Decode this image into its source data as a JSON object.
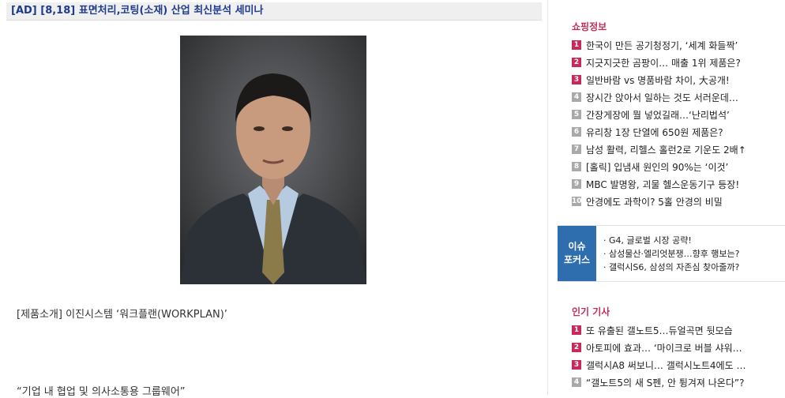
{
  "ad": {
    "title": "[AD] [8,18] 표면처리,코팅(소재) 산업 최신분석 세미나"
  },
  "article": {
    "photo_alt": "인물 사진",
    "caption": "[제품소개] 이진시스템 ‘워크플랜(WORKPLAN)’",
    "quote": "“기업 내 협업 및 의사소통용 그룹웨어”"
  },
  "shopping": {
    "title": "쇼핑정보",
    "items": [
      {
        "num": "1",
        "text": "한국이 만든 공기청정기, ‘세계 화들짝’",
        "hot": true
      },
      {
        "num": "2",
        "text": "지긋지긋한 곰팡이… 매출 1위 제품은?",
        "hot": true
      },
      {
        "num": "3",
        "text": "일반바람 vs 명품바람 차이, 大공개!",
        "hot": true
      },
      {
        "num": "4",
        "text": "장시간 앉아서 일하는 것도 서러운데…",
        "hot": false
      },
      {
        "num": "5",
        "text": "간장게장에 뭘 넣었길래…‘난리법석’",
        "hot": false
      },
      {
        "num": "6",
        "text": "유리창 1장 단열에 650원 제품은?",
        "hot": false
      },
      {
        "num": "7",
        "text": "남성 활력, 리헬스 홀런2로 기운도 2배↑",
        "hot": false
      },
      {
        "num": "8",
        "text": "[홀릭] 입냄새 원인의 90%는 ‘이것’",
        "hot": false
      },
      {
        "num": "9",
        "text": "MBC 발명왕, 괴물 헬스운동기구 등장!",
        "hot": false
      },
      {
        "num": "10",
        "text": "안경에도 과학이? 5홀 안경의 비밀",
        "hot": false
      }
    ]
  },
  "issue": {
    "badge_line1": "이슈",
    "badge_line2": "포커스",
    "items": [
      "· G4, 글로벌 시장 공략!",
      "· 삼성물산·엘리엇분쟁…향후 행보는?",
      "· 갤럭시S6, 삼성의 자존심 찾아줄까?"
    ]
  },
  "popular": {
    "title": "인기 기사",
    "items": [
      {
        "num": "1",
        "text": "또 유출된 갤노트5…듀얼곡면 뒷모습",
        "hot": true
      },
      {
        "num": "2",
        "text": "아토피에 효과… ‘마이크로 버블 샤워…",
        "hot": true
      },
      {
        "num": "3",
        "text": "갤럭시A8 써보니… 갤럭시노트4에도 …",
        "hot": true
      },
      {
        "num": "4",
        "text": "“갤노트5의 새 S펜, 안 튕겨져 나온다”?",
        "hot": false
      }
    ]
  }
}
